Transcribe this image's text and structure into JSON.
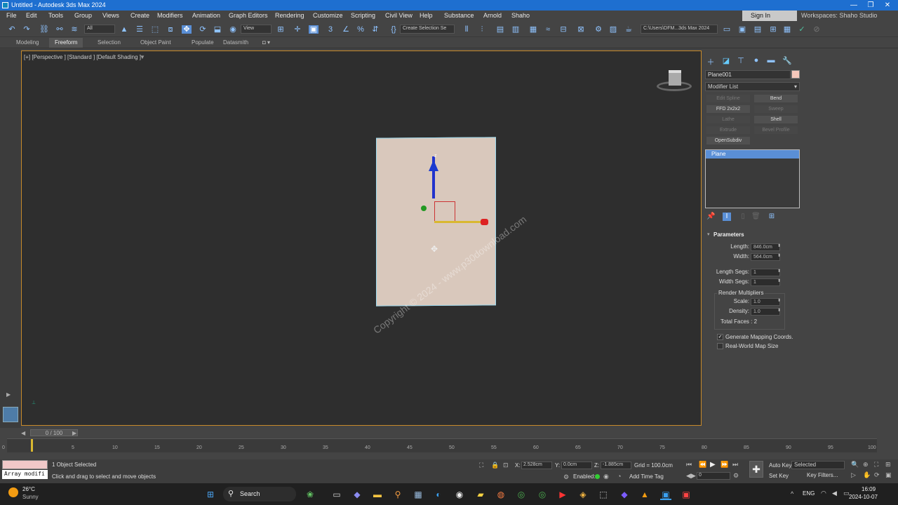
{
  "window": {
    "title": "Untitled - Autodesk 3ds Max 2024"
  },
  "menu": [
    "File",
    "Edit",
    "Tools",
    "Group",
    "Views",
    "Create",
    "Modifiers",
    "Animation",
    "Graph Editors",
    "Rendering",
    "Customize",
    "Scripting",
    "Civil View",
    "Help",
    "Substance",
    "Arnold",
    "Shaho"
  ],
  "signin": "Sign In",
  "workspace": {
    "label": "Workspaces:",
    "value": "Shaho Studio"
  },
  "toolbar": {
    "filter": "All",
    "view": "View",
    "selset": "Create Selection Se",
    "path": "C:\\Users\\DFM...3ds Max 2024"
  },
  "ribbon": [
    "Modeling",
    "Freeform",
    "Selection",
    "Object Paint",
    "Populate",
    "Datasmith"
  ],
  "viewport": {
    "label": "[+] [Perspective ] [Standard ] [Default Shading ]",
    "watermark": "Copyright © 2024 - www.p30download.com",
    "axis_z": "z"
  },
  "command": {
    "object_name": "Plane001",
    "object_color": "#f6c8bc",
    "modifier_list": "Modifier List",
    "modifier_buttons": [
      {
        "label": "Edit Spline",
        "enabled": false
      },
      {
        "label": "Bend",
        "enabled": true
      },
      {
        "label": "FFD 2x2x2",
        "enabled": true
      },
      {
        "label": "Sweep",
        "enabled": false
      },
      {
        "label": "Lathe",
        "enabled": false
      },
      {
        "label": "Shell",
        "enabled": true
      },
      {
        "label": "Extrude",
        "enabled": false
      },
      {
        "label": "Bevel Profile",
        "enabled": false
      },
      {
        "label": "OpenSubdiv",
        "enabled": true
      }
    ],
    "stack": [
      "Plane"
    ]
  },
  "parameters": {
    "title": "Parameters",
    "length_label": "Length:",
    "length": "846.0cm",
    "width_label": "Width:",
    "width": "564.0cm",
    "lsegs_label": "Length Segs:",
    "lsegs": "1",
    "wsegs_label": "Width Segs:",
    "wsegs": "1",
    "render_mult": "Render Multipliers",
    "scale_label": "Scale:",
    "scale": "1.0",
    "density_label": "Density:",
    "density": "1.0",
    "total_faces": "Total Faces : 2",
    "gen_map": "Generate Mapping Coords.",
    "gen_map_checked": true,
    "real_world": "Real-World Map Size",
    "real_world_checked": false
  },
  "timeline": {
    "slider": "0 / 100",
    "ticks": [
      "0",
      "5",
      "10",
      "15",
      "20",
      "25",
      "30",
      "35",
      "40",
      "45",
      "50",
      "55",
      "60",
      "65",
      "70",
      "75",
      "80",
      "85",
      "90",
      "95",
      "100"
    ]
  },
  "status": {
    "script": "Array modifi",
    "selected": "1 Object Selected",
    "prompt": "Click and drag to select and move objects",
    "x_label": "X:",
    "x": "2.528cm",
    "y_label": "Y:",
    "y": "0.0cm",
    "z_label": "Z:",
    "z": "-1.885cm",
    "grid": "Grid = 100.0cm",
    "enabled": "Enabled:",
    "add_time_tag": "Add Time Tag",
    "auto_key": "Auto Key",
    "set_key": "Set Key",
    "key_mode": "Selected",
    "key_filters": "Key Filters...",
    "frame": "0"
  },
  "taskbar": {
    "temp": "26°C",
    "weather": "Sunny",
    "search": "Search",
    "lang": "ENG",
    "time": "16:09",
    "date": "2024-10-07"
  }
}
